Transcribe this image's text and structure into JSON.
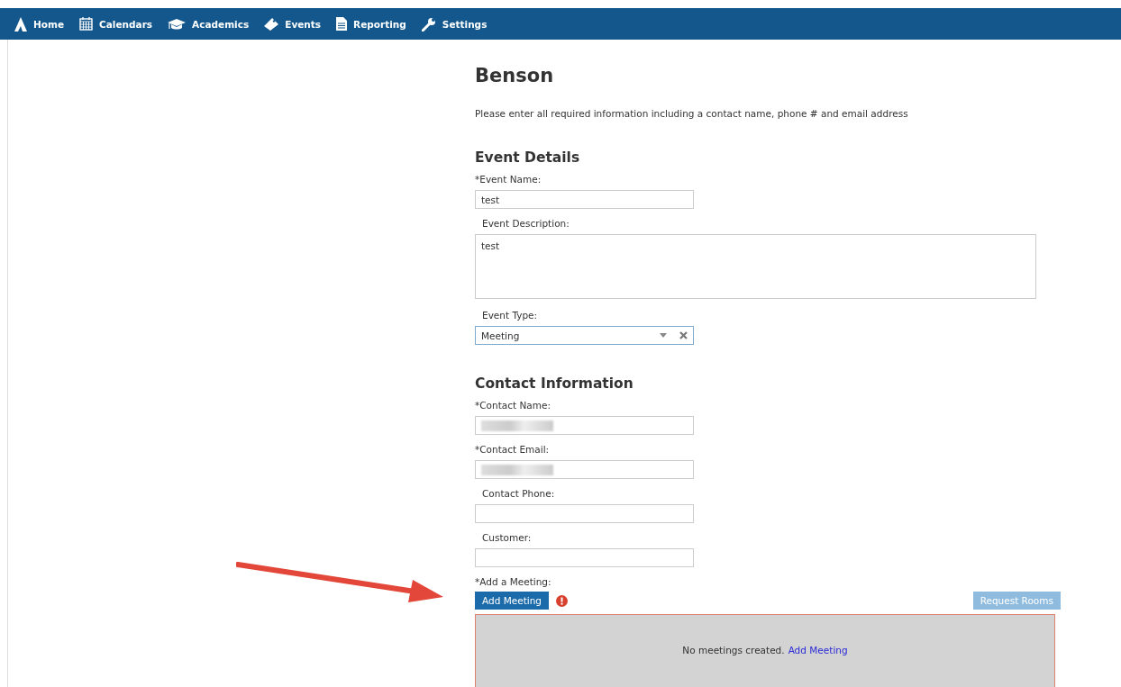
{
  "nav": {
    "items": [
      {
        "label": "Home"
      },
      {
        "label": "Calendars"
      },
      {
        "label": "Academics"
      },
      {
        "label": "Events"
      },
      {
        "label": "Reporting"
      },
      {
        "label": "Settings"
      }
    ]
  },
  "page": {
    "title": "Benson",
    "instructions": "Please enter all required information including a contact name, phone # and email address"
  },
  "sections": [
    {
      "heading": "Event Details",
      "fields": [
        {
          "label": "*Event Name:",
          "indented": false,
          "kind": "text",
          "value": "test"
        },
        {
          "label": "Event Description:",
          "indented": true,
          "kind": "textarea",
          "value": "test"
        },
        {
          "label": "Event Type:",
          "indented": true,
          "kind": "select",
          "value": "Meeting"
        }
      ]
    },
    {
      "heading": "Contact Information",
      "fields": [
        {
          "label": "*Contact Name:",
          "indented": false,
          "kind": "redacted"
        },
        {
          "label": "*Contact Email:",
          "indented": false,
          "kind": "redacted"
        },
        {
          "label": "Contact Phone:",
          "indented": true,
          "kind": "text"
        },
        {
          "label": "Customer:",
          "indented": true,
          "kind": "text"
        }
      ]
    }
  ],
  "meetings": {
    "label": "*Add a Meeting:",
    "add_button": "Add Meeting",
    "error": true,
    "request_button": {
      "label": "Request Rooms",
      "disabled": true
    },
    "empty_text": "No meetings created.",
    "empty_link": "Add Meeting"
  }
}
